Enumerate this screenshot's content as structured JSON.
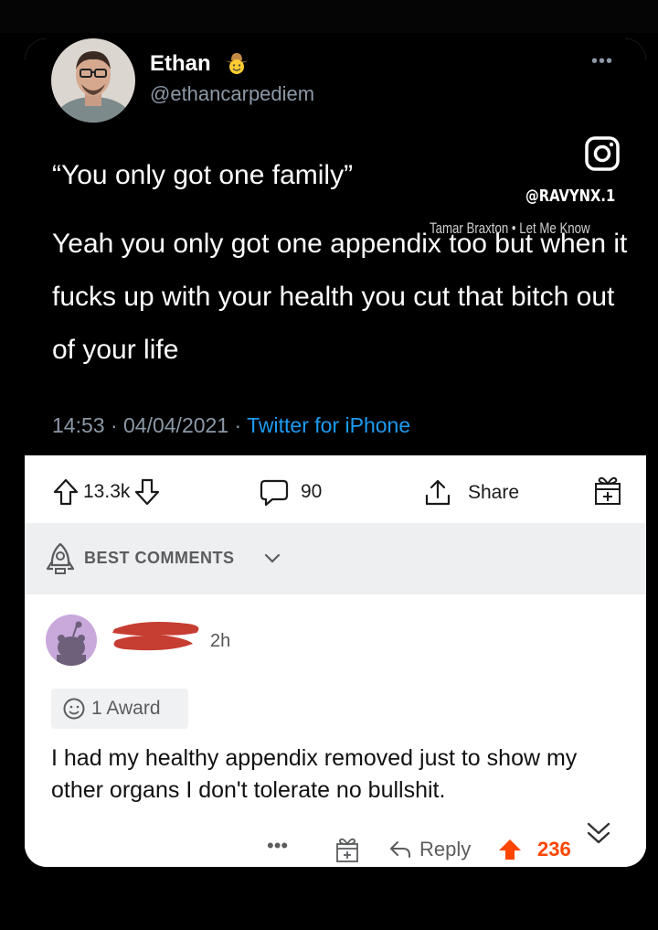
{
  "tweet": {
    "display_name": "Ethan",
    "handle": "@ethancarpediem",
    "more_label": "•••",
    "quote": "“You only got one family”",
    "body": "Yeah you only got one appendix too but when it fucks up with your health you cut that bitch out of your life",
    "timestamp": "14:53 · 04/04/2021 · ",
    "source": "Twitter for iPhone",
    "watermark": "@RAVYNX.1",
    "song_credit": "Tamar Braxton • Let Me Know"
  },
  "actions": {
    "upvotes": "13.3k",
    "comments": "90",
    "share_label": "Share"
  },
  "sort": {
    "label": "BEST COMMENTS"
  },
  "comment": {
    "time": "2h",
    "award_label": "1 Award",
    "body": "I had my healthy appendix removed just to show my other organs I don't tolerate no bullshit.",
    "more_label": "•••",
    "reply_label": "Reply",
    "score": "236"
  },
  "colors": {
    "twitter_blue": "#1d9bf0",
    "reddit_orange": "#ff4500",
    "muted_gray": "#8b98a5",
    "redaction_red": "#c0281c"
  },
  "icons": {
    "verified_emoji": "cowboy-emoji-icon",
    "instagram": "instagram-icon",
    "upvote": "arrow-up-icon",
    "downvote": "arrow-down-icon",
    "comment": "speech-bubble-icon",
    "share": "share-icon",
    "gift": "gift-icon",
    "sort": "rocket-icon",
    "award": "award-icon",
    "reply": "reply-icon",
    "collapse": "double-chevron-down-icon"
  }
}
